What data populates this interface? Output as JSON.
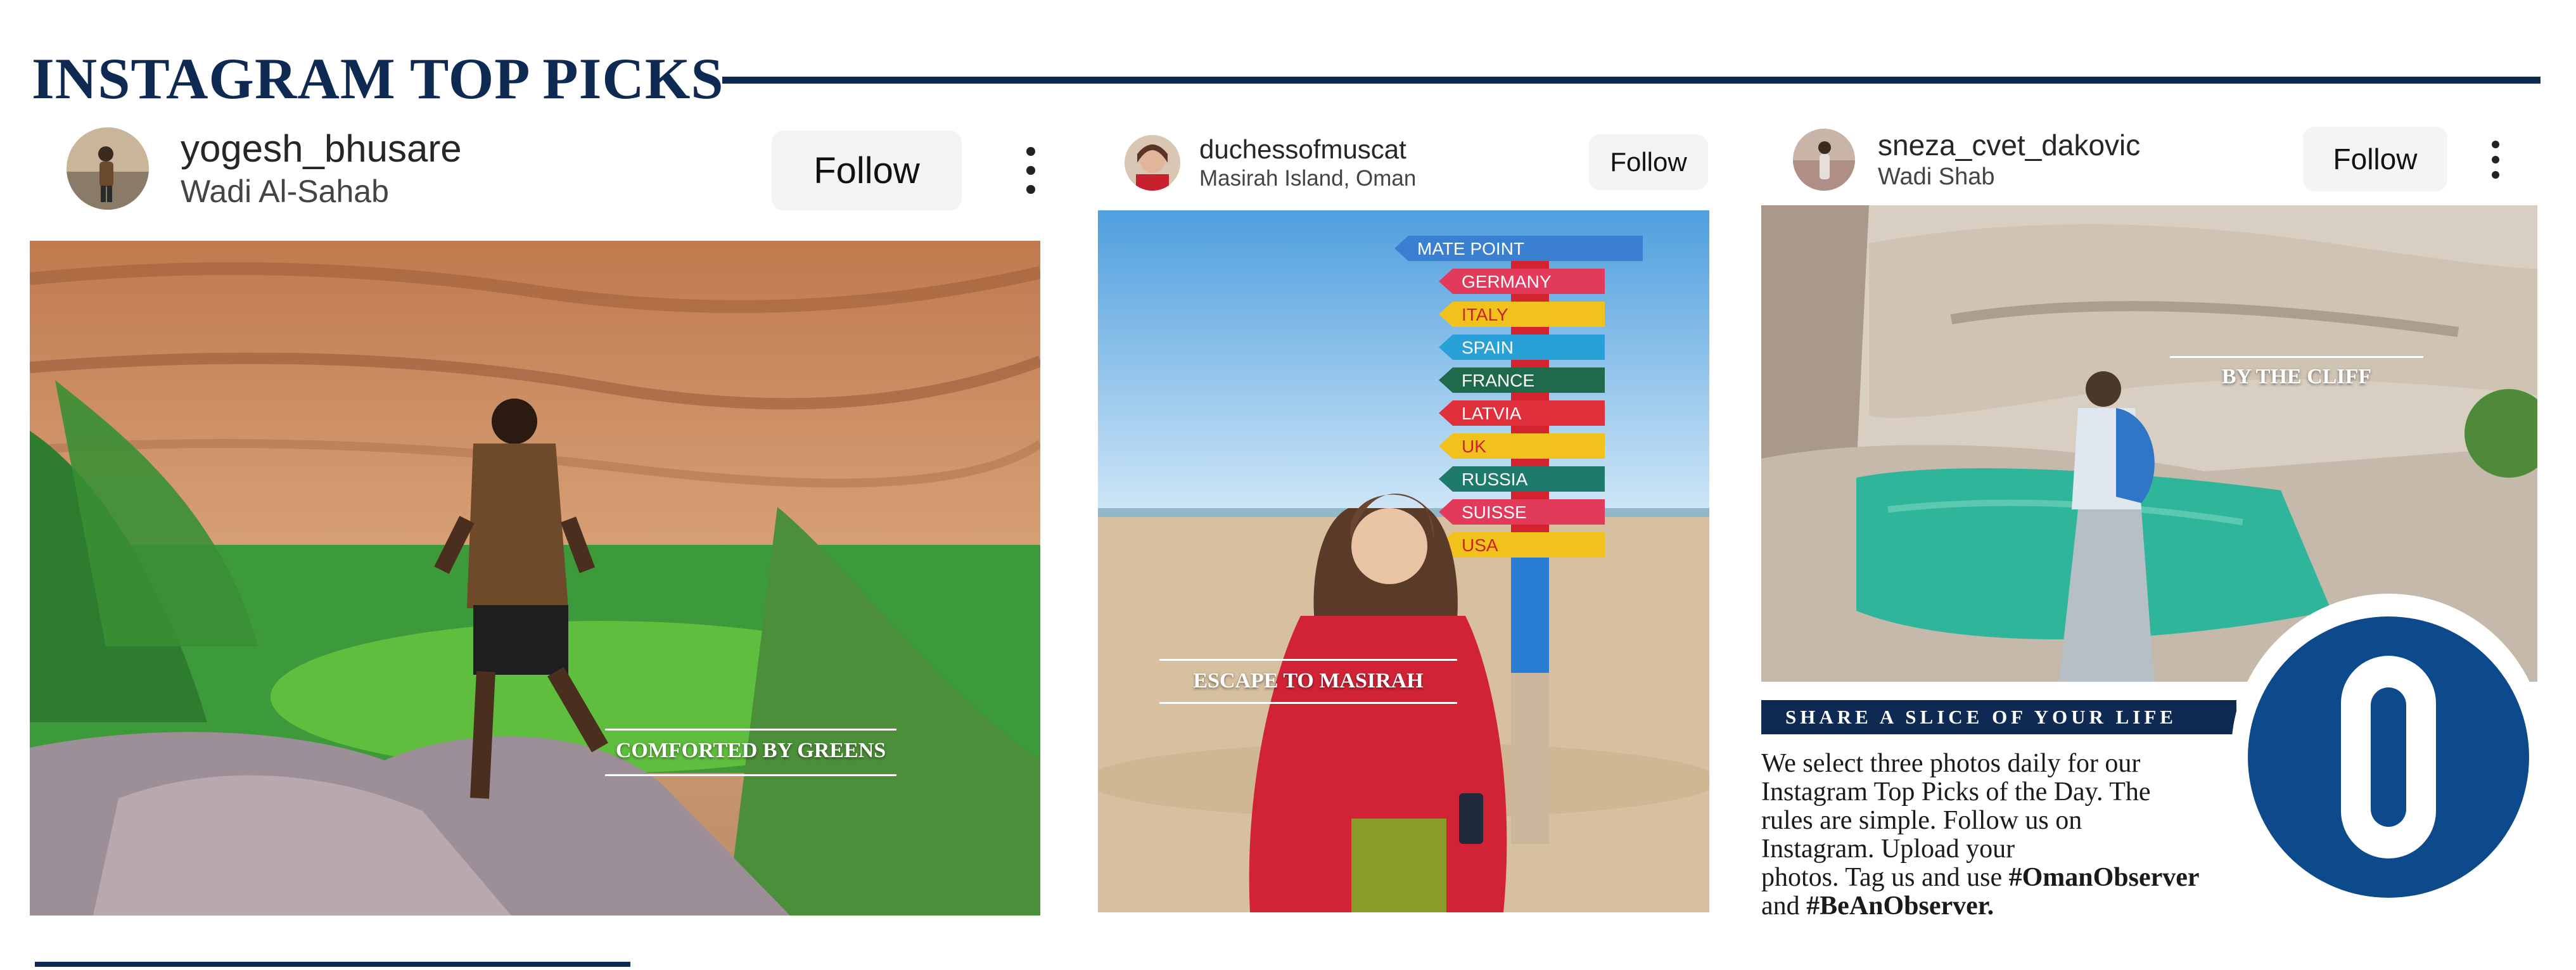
{
  "header": {
    "title": "INSTAGRAM TOP PICKS"
  },
  "posts": [
    {
      "username": "yogesh_bhusare",
      "location": "Wadi Al-Sahab",
      "follow_label": "Follow",
      "caption": "COMFORTED BY GREENS"
    },
    {
      "username": "duchessofmuscat",
      "location": "Masirah Island, Oman",
      "follow_label": "Follow",
      "caption": "ESCAPE TO MASIRAH"
    },
    {
      "username": "sneza_cvet_dakovic",
      "location": "Wadi Shab",
      "follow_label": "Follow",
      "caption": "BY THE CLIFF"
    }
  ],
  "signpost": [
    "MATE POINT",
    "GERMANY",
    "ITALY",
    "SPAIN",
    "FRANCE",
    "LATVIA",
    "UK",
    "RUSSIA",
    "SUISSE",
    "USA"
  ],
  "share": {
    "banner": "SHARE A SLICE OF YOUR LIFE",
    "body_lines": [
      "We select three photos daily for our",
      "Instagram Top Picks of the Day. The",
      "rules are simple. Follow us on",
      "Instagram. Upload your"
    ],
    "line5_prefix": "photos. Tag us and use ",
    "hashtag1": "#OmanObserver",
    "line6_prefix": "and ",
    "hashtag2": "#BeAnObserver."
  },
  "logo_letter": "O",
  "colors": {
    "navy": "#0f2a52",
    "logo_blue": "#0d4a8c"
  }
}
